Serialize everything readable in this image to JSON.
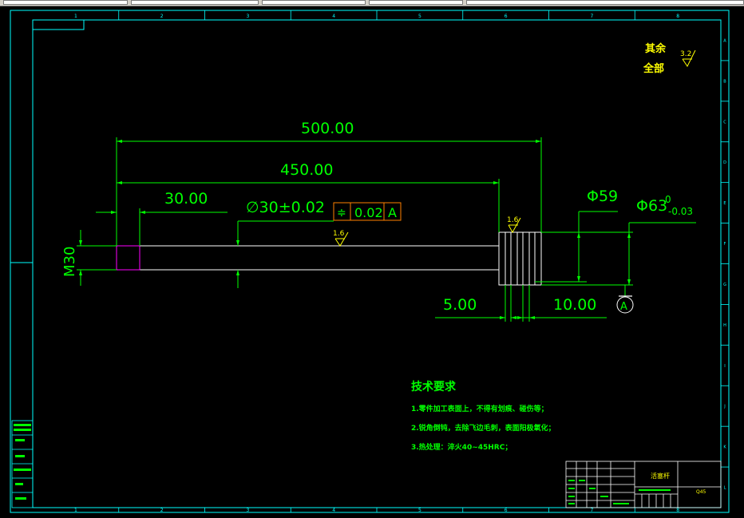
{
  "toolbar": {
    "field_labels": [
      "",
      "",
      "",
      "",
      "",
      ""
    ]
  },
  "drawing": {
    "column_labels": [
      "1",
      "2",
      "3",
      "4",
      "5",
      "6",
      "7",
      "8"
    ],
    "row_labels": [
      "A",
      "B",
      "C",
      "D",
      "E",
      "F",
      "G",
      "H",
      "I",
      "J",
      "K",
      "L"
    ],
    "surface_note": {
      "line1": "其余",
      "line2": "全部",
      "roughness": "3.2"
    },
    "dims": {
      "total_length": "500.00",
      "rod_length": "450.00",
      "thread_length": "30.00",
      "rod_dia": "∅30±0.02",
      "tolerance_symbol": "≑",
      "tolerance_value": "0.02",
      "datum": "A",
      "thread": "M30",
      "rod_roughness": "1.6",
      "head_roughness": "1.6",
      "dia_59": "Φ59",
      "dia_63": "Φ63",
      "dia_63_upper": "0",
      "dia_63_lower": "-0.03",
      "groove_width": "5.00",
      "head_width": "10.00",
      "datum_circle": "A"
    },
    "tech_req": {
      "title": "技术要求",
      "items": [
        "1.零件加工表面上，不得有划痕、碰伤等；",
        "2.锐角倒钝，去除飞边毛刺，表面阳极氧化；",
        "3.热处理：淬火40~45HRC；"
      ]
    },
    "title_block": {
      "part_name": "活塞杆",
      "code": "Q45"
    }
  },
  "colors": {
    "frame": "#00ffff",
    "dimension": "#00ff00",
    "outline": "#ffffff",
    "thread_box": "#ff00ff",
    "tolerance_frame": "#ff8000",
    "text_yellow": "#ffff00"
  }
}
